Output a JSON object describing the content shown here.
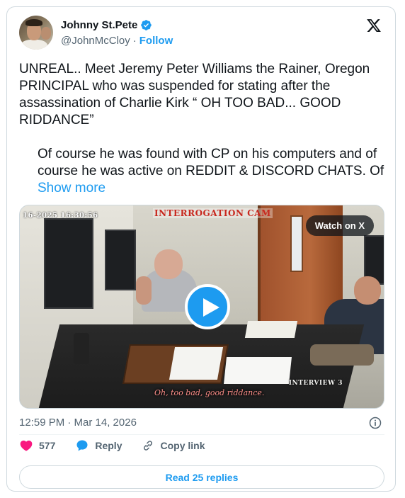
{
  "author": {
    "display_name": "Johnny St.Pete",
    "handle": "@JohnMcCloy",
    "separator": "·",
    "follow_label": "Follow",
    "verified": true
  },
  "tweet": {
    "paragraph1": "UNREAL.. Meet Jeremy Peter Williams the Rainer, Oregon PRINCIPAL who was suspended for stating after the assassination of Charlie Kirk “ OH TOO BAD... GOOD RIDDANCE”",
    "paragraph2": "Of course he was found with CP on his computers and of course he was active on REDDIT & DISCORD CHATS. Of",
    "show_more": "Show more"
  },
  "media": {
    "watch_label": "Watch on X",
    "overlay_timestamp": "16-2025  16:30:56",
    "overlay_title": "INTERROGATION CAM",
    "overlay_interview": "INTERVIEW 3",
    "overlay_caption": "Oh, too bad, good riddance."
  },
  "meta": {
    "timestamp": "12:59 PM · Mar 14, 2026"
  },
  "actions": {
    "like_count": "577",
    "reply_label": "Reply",
    "copy_link_label": "Copy link"
  },
  "footer": {
    "read_replies_label": "Read 25 replies"
  },
  "colors": {
    "accent": "#1d9bf0",
    "like": "#f91880",
    "text": "#0f1419",
    "secondary_text": "#536471",
    "border": "#cfd9de"
  },
  "icons": {
    "verified": "verified-badge-icon",
    "x_logo": "x-logo-icon",
    "play": "play-icon",
    "info": "info-icon",
    "like": "heart-icon",
    "reply": "speech-bubble-icon",
    "copy_link": "link-icon"
  }
}
